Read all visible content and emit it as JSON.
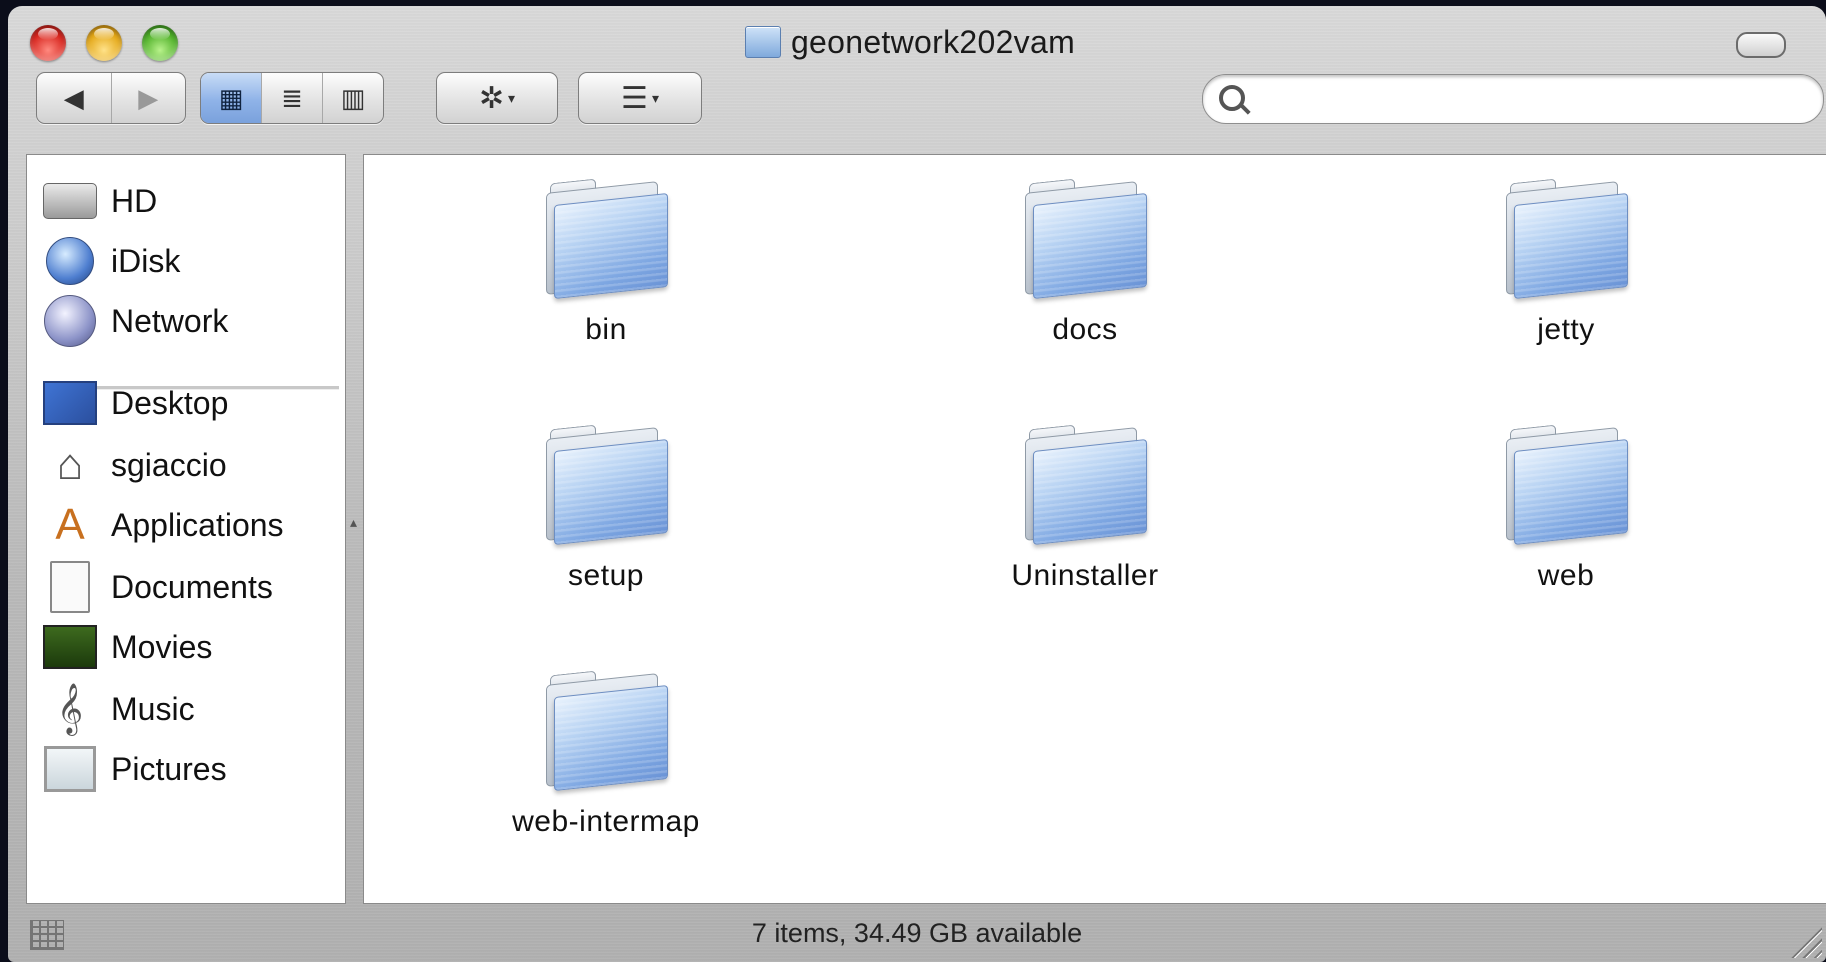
{
  "window": {
    "title": "geonetwork202vam"
  },
  "toolbar": {
    "back_label": "◀",
    "forward_label": "▶",
    "view_icon_label": "▦",
    "view_list_label": "≣",
    "view_column_label": "▥",
    "action_label": "✲",
    "arrange_label": "☰",
    "caret": "▾",
    "search_placeholder": "",
    "search_value": ""
  },
  "sidebar": {
    "devices": [
      {
        "label": "HD",
        "icon": "hard-disk-icon"
      },
      {
        "label": "iDisk",
        "icon": "idisk-icon"
      },
      {
        "label": "Network",
        "icon": "network-globe-icon"
      }
    ],
    "places": [
      {
        "label": "Desktop",
        "icon": "desktop-icon"
      },
      {
        "label": "sgiaccio",
        "icon": "home-icon",
        "glyph": "⌂"
      },
      {
        "label": "Applications",
        "icon": "applications-icon",
        "glyph": "A"
      },
      {
        "label": "Documents",
        "icon": "documents-icon"
      },
      {
        "label": "Movies",
        "icon": "movies-icon"
      },
      {
        "label": "Music",
        "icon": "music-icon",
        "glyph": "𝄞"
      },
      {
        "label": "Pictures",
        "icon": "pictures-icon"
      }
    ]
  },
  "folders": [
    {
      "name": "bin"
    },
    {
      "name": "docs"
    },
    {
      "name": "jetty"
    },
    {
      "name": "setup"
    },
    {
      "name": "Uninstaller"
    },
    {
      "name": "web"
    },
    {
      "name": "web-intermap"
    }
  ],
  "status": {
    "text": "7 items, 34.49 GB available"
  },
  "colors": {
    "selected_view": "#8fb3e8",
    "folder_blue": "#7ea7e2"
  }
}
